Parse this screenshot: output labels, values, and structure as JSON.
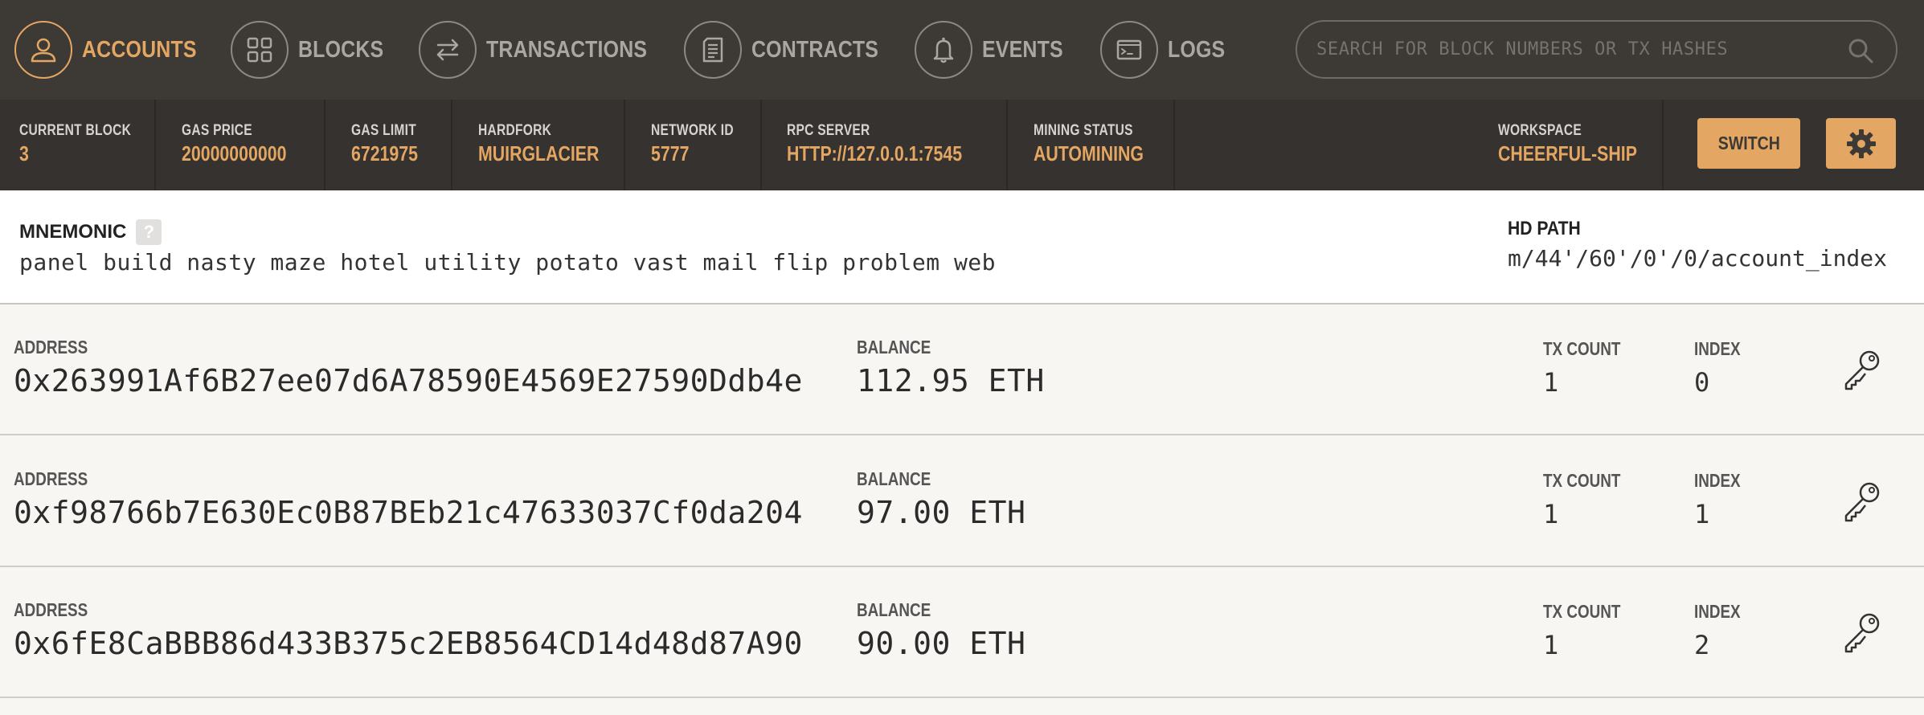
{
  "nav": {
    "items": [
      {
        "label": "ACCOUNTS",
        "icon": "user-icon",
        "active": true
      },
      {
        "label": "BLOCKS",
        "icon": "grid-icon"
      },
      {
        "label": "TRANSACTIONS",
        "icon": "swap-arrows-icon"
      },
      {
        "label": "CONTRACTS",
        "icon": "document-icon"
      },
      {
        "label": "EVENTS",
        "icon": "bell-icon"
      },
      {
        "label": "LOGS",
        "icon": "terminal-icon"
      }
    ],
    "search_placeholder": "SEARCH FOR BLOCK NUMBERS OR TX HASHES"
  },
  "status": {
    "current_block": {
      "label": "CURRENT BLOCK",
      "value": "3"
    },
    "gas_price": {
      "label": "GAS PRICE",
      "value": "20000000000"
    },
    "gas_limit": {
      "label": "GAS LIMIT",
      "value": "6721975"
    },
    "hardfork": {
      "label": "HARDFORK",
      "value": "MUIRGLACIER"
    },
    "network_id": {
      "label": "NETWORK ID",
      "value": "5777"
    },
    "rpc_server": {
      "label": "RPC SERVER",
      "value": "HTTP://127.0.0.1:7545"
    },
    "mining_status": {
      "label": "MINING STATUS",
      "value": "AUTOMINING"
    },
    "workspace": {
      "label": "WORKSPACE",
      "value": "CHEERFUL-SHIP"
    },
    "switch_label": "SWITCH"
  },
  "mnemonic": {
    "title": "MNEMONIC",
    "help": "?",
    "words": "panel build nasty maze hotel utility potato vast mail flip problem web",
    "hd_path_title": "HD PATH",
    "hd_path": "m/44'/60'/0'/0/account_index"
  },
  "accounts": {
    "address_label": "ADDRESS",
    "balance_label": "BALANCE",
    "tx_count_label": "TX COUNT",
    "index_label": "INDEX",
    "rows": [
      {
        "address": "0x263991Af6B27ee07d6A78590E4569E27590Ddb4e",
        "balance": "112.95 ETH",
        "tx_count": "1",
        "index": "0"
      },
      {
        "address": "0xf98766b7E630Ec0B87BEb21c47633037Cf0da204",
        "balance": "97.00 ETH",
        "tx_count": "1",
        "index": "1"
      },
      {
        "address": "0x6fE8CaBBB86d433B375c2EB8564CD14d48d87A90",
        "balance": "90.00 ETH",
        "tx_count": "1",
        "index": "2"
      }
    ]
  },
  "colors": {
    "accent": "#e4a663",
    "nav_bg": "#3d3935",
    "status_bg": "#35322f"
  }
}
